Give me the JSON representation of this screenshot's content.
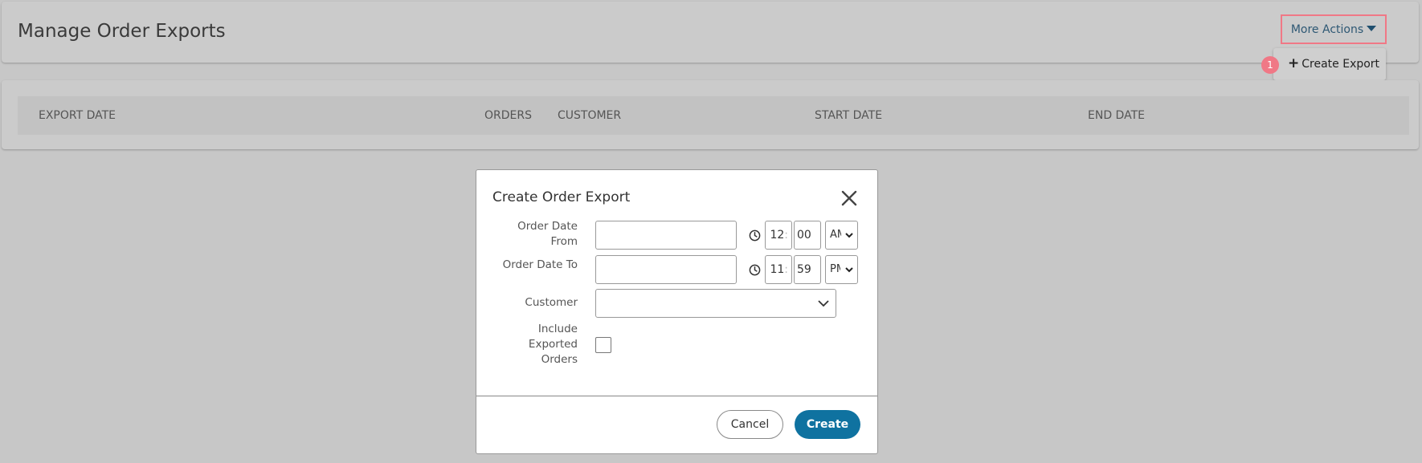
{
  "page": {
    "title": "Manage Order Exports"
  },
  "toolbar": {
    "more_actions_label": "More Actions",
    "menu": {
      "create_export_label": "Create Export"
    },
    "step_badge": "1"
  },
  "table": {
    "columns": [
      "EXPORT DATE",
      "ORDERS",
      "CUSTOMER",
      "START DATE",
      "END DATE"
    ]
  },
  "modal": {
    "title": "Create Order Export",
    "fields": {
      "order_date_from": {
        "label_line1": "Order Date",
        "label_line2": "From",
        "date_value": "",
        "hour": "12",
        "minute": "00",
        "ampm": "AM"
      },
      "order_date_to": {
        "label": "Order Date To",
        "date_value": "",
        "hour": "11",
        "minute": "59",
        "ampm": "PM"
      },
      "customer": {
        "label": "Customer",
        "value": ""
      },
      "include_exported": {
        "label_line1": "Include",
        "label_line2": "Exported",
        "label_line3": "Orders",
        "checked": false
      }
    },
    "cancel_label": "Cancel",
    "create_label": "Create"
  },
  "colors": {
    "accent": "#0f72a0",
    "highlight": "#f07886",
    "overlay": "#c7c7c7"
  },
  "icons": {
    "close": "close-icon",
    "clock": "clock-icon",
    "caret": "caret-down-icon",
    "plus": "plus-icon",
    "chevron": "chevron-down-icon"
  }
}
